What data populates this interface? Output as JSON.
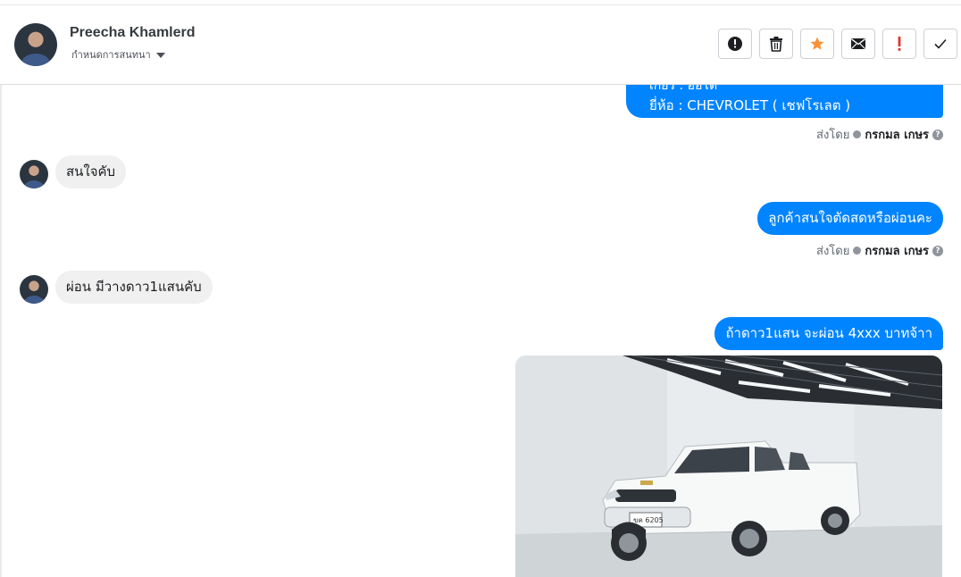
{
  "header": {
    "contact_name": "Preecha Khamlerd",
    "convo_setting_label": "กำหนดการสนทนา",
    "actions": [
      {
        "name": "report-button",
        "icon": "exclamation-circle-icon"
      },
      {
        "name": "delete-button",
        "icon": "trash-icon"
      },
      {
        "name": "star-button",
        "icon": "star-icon"
      },
      {
        "name": "mark-unread-button",
        "icon": "envelope-icon"
      },
      {
        "name": "important-button",
        "icon": "exclamation-icon"
      },
      {
        "name": "done-button",
        "icon": "check-icon"
      }
    ]
  },
  "messages": {
    "m1_line_partial": "เกียร์ : ออโต้",
    "m1_line2": "ยี่ห้อ : CHEVROLET ( เชฟโรเลต )",
    "sent_by_label": "ส่งโดย",
    "agent_name": "กรกมล เกษร",
    "m2_in": "สนใจคับ",
    "m3_out": "ลูกค้าสนใจตัดสดหรือผ่อนคะ",
    "m4_in": "ผ่อน  มีวางดาว1แสนคับ",
    "m5_out": "ถ้าดาว1แสน จะผ่อน 4xxx บาทจ้าา",
    "m5_photo_plate": "ขค 6205"
  },
  "colors": {
    "outgoing_bubble": "#0084ff",
    "incoming_bubble": "#f0f0f0",
    "star_accent": "#f7923b",
    "important_accent": "#e0362c"
  }
}
